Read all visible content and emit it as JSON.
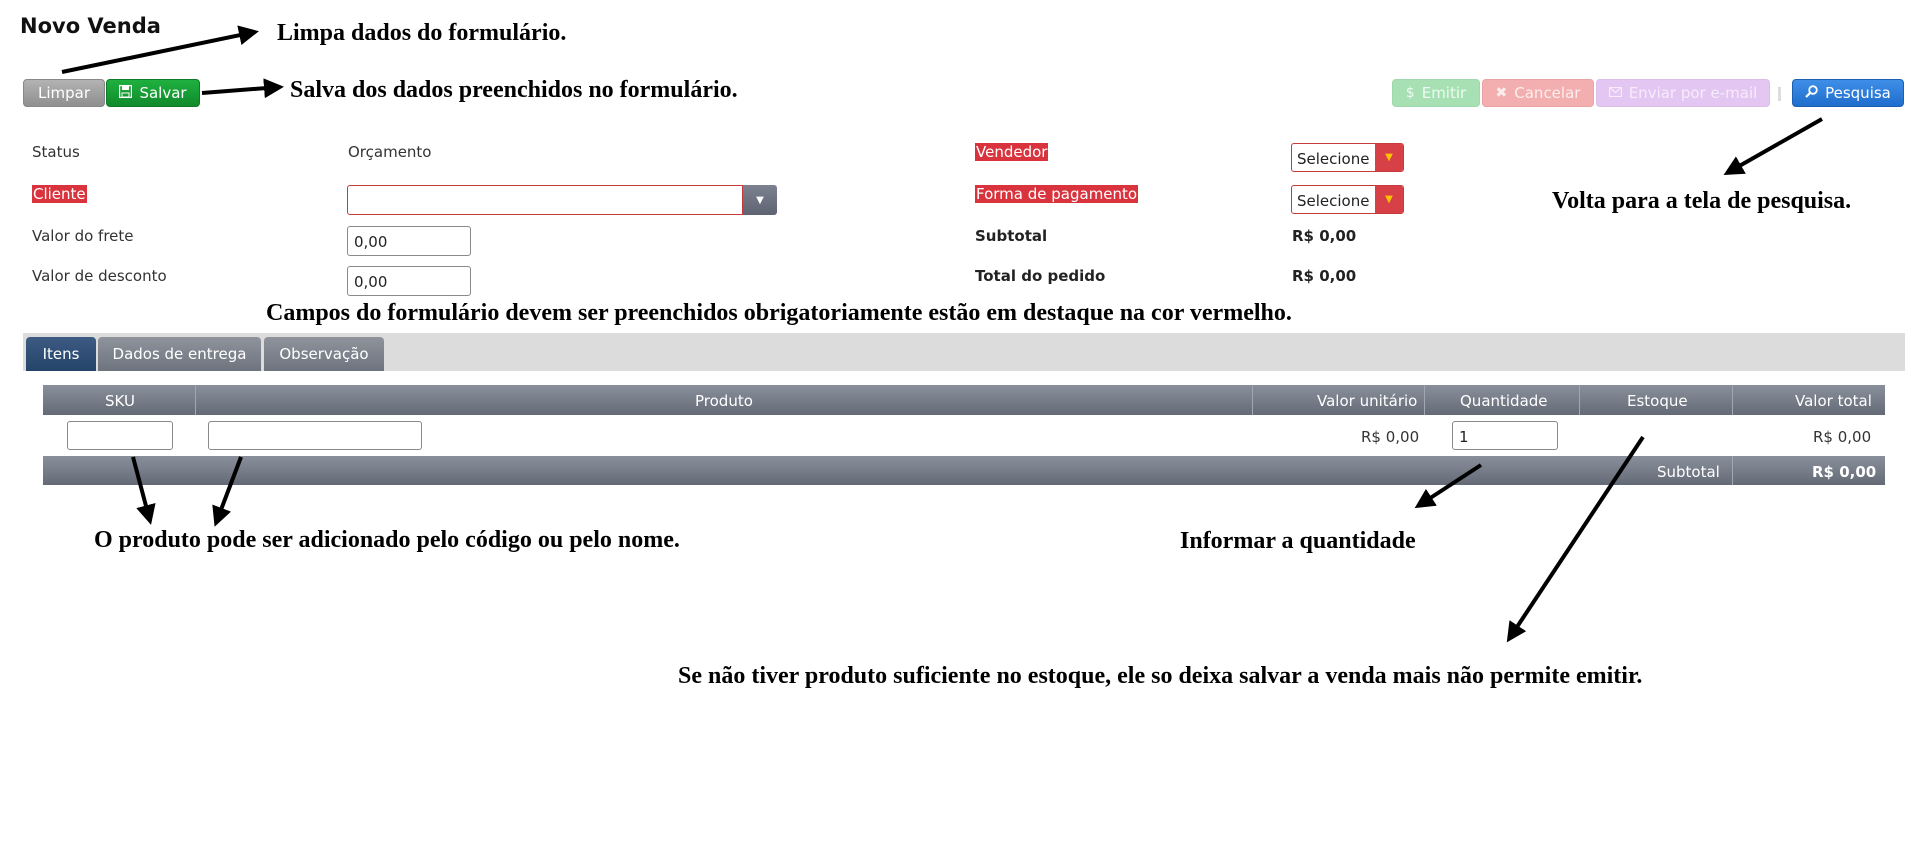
{
  "page": {
    "title": "Novo Venda"
  },
  "toolbar": {
    "limpar_label": "Limpar",
    "salvar_label": "Salvar",
    "emitir_label": "Emitir",
    "cancelar_label": "Cancelar",
    "email_label": "Enviar por e-mail",
    "pesquisa_label": "Pesquisa"
  },
  "form": {
    "status_label": "Status",
    "status_value": "Orçamento",
    "cliente_label": "Cliente",
    "cliente_value": "",
    "frete_label": "Valor do frete",
    "frete_value": "0,00",
    "desconto_label": "Valor de desconto",
    "desconto_value": "0,00",
    "vendedor_label": "Vendedor",
    "vendedor_value": "Selecione",
    "pagamento_label": "Forma de pagamento",
    "pagamento_value": "Selecione",
    "subtotal_label": "Subtotal",
    "subtotal_value": "R$ 0,00",
    "total_label": "Total do pedido",
    "total_value": "R$ 0,00"
  },
  "tabs": [
    {
      "label": "Itens",
      "active": true
    },
    {
      "label": "Dados de entrega",
      "active": false
    },
    {
      "label": "Observação",
      "active": false
    }
  ],
  "items_table": {
    "headers": [
      "SKU",
      "Produto",
      "Valor unitário",
      "Quantidade",
      "Estoque",
      "Valor total"
    ],
    "row": {
      "sku": "",
      "produto": "",
      "valor_unitario": "R$ 0,00",
      "quantidade": "1",
      "estoque": "",
      "valor_total": "R$ 0,00"
    },
    "footer_label": "Subtotal",
    "footer_value": "R$ 0,00"
  },
  "annotations": {
    "limpar": "Limpa dados do formulário.",
    "salvar": "Salva dos dados preenchidos no formulário.",
    "pesquisa": "Volta para a tela de pesquisa.",
    "obrigatorios": "Campos do formulário devem ser preenchidos obrigatoriamente estão em destaque na cor vermelho.",
    "produto": "O produto pode ser adicionado pelo código ou pelo nome.",
    "quantidade": "Informar a quantidade",
    "estoque": "Se não tiver produto suficiente no estoque, ele so deixa salvar a venda mais não permite emitir."
  },
  "colors": {
    "required": "#d9343e",
    "salvar": "#16a035",
    "pesquisa": "#2a7ad8",
    "active_tab": "#2f4e76"
  },
  "icons": [
    "save-icon",
    "dollar-icon",
    "x-icon",
    "envelope-icon",
    "search-icon",
    "caret-down-icon"
  ]
}
